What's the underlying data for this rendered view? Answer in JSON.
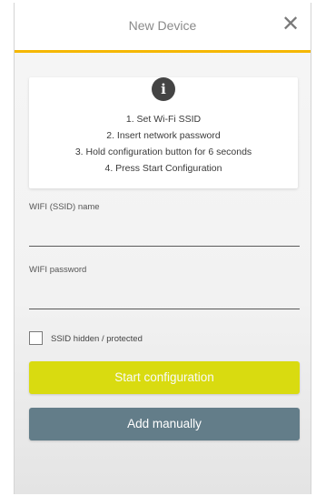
{
  "header": {
    "title": "New Device",
    "close_icon": "close-icon"
  },
  "info": {
    "icon": "info-icon",
    "icon_glyph": "i",
    "steps": [
      "1. Set Wi-Fi SSID",
      "2. Insert network password",
      "3. Hold configuration button for 6 seconds",
      "4. Press Start Configuration"
    ]
  },
  "form": {
    "ssid_label": "WIFI (SSID) name",
    "ssid_value": "",
    "password_label": "WIFI password",
    "password_value": "",
    "hidden_checkbox_label": "SSID hidden / protected",
    "hidden_checked": false
  },
  "buttons": {
    "start_label": "Start configuration",
    "manual_label": "Add manually"
  },
  "colors": {
    "accent": "#f5b700",
    "start_button": "#d9db10",
    "manual_button": "#637d89"
  }
}
